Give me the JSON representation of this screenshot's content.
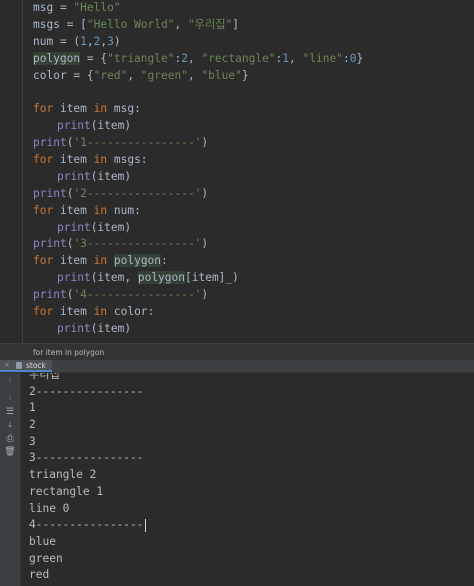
{
  "code": {
    "lines": [
      [
        {
          "t": "msg = "
        },
        {
          "t": "\"Hello\"",
          "c": "str"
        }
      ],
      [
        {
          "t": "msgs = ["
        },
        {
          "t": "\"Hello World\"",
          "c": "str"
        },
        {
          "t": ", "
        },
        {
          "t": "\"우리집\"",
          "c": "str"
        },
        {
          "t": "]"
        }
      ],
      [
        {
          "t": "num = ("
        },
        {
          "t": "1",
          "c": "num"
        },
        {
          "t": ","
        },
        {
          "t": "2",
          "c": "num"
        },
        {
          "t": ","
        },
        {
          "t": "3",
          "c": "num"
        },
        {
          "t": ")"
        }
      ],
      [
        {
          "t": "polygon",
          "c": "hl"
        },
        {
          "t": " = {"
        },
        {
          "t": "\"triangle\"",
          "c": "str"
        },
        {
          "t": ":"
        },
        {
          "t": "2",
          "c": "num"
        },
        {
          "t": ", "
        },
        {
          "t": "\"rectangle\"",
          "c": "str"
        },
        {
          "t": ":"
        },
        {
          "t": "1",
          "c": "num"
        },
        {
          "t": ", "
        },
        {
          "t": "\"line\"",
          "c": "str"
        },
        {
          "t": ":"
        },
        {
          "t": "0",
          "c": "num"
        },
        {
          "t": "}"
        }
      ],
      [
        {
          "t": "color = {"
        },
        {
          "t": "\"red\"",
          "c": "str"
        },
        {
          "t": ", "
        },
        {
          "t": "\"green\"",
          "c": "str"
        },
        {
          "t": ", "
        },
        {
          "t": "\"blue\"",
          "c": "str"
        },
        {
          "t": "}"
        }
      ],
      [],
      [
        {
          "t": "for",
          "c": "kw"
        },
        {
          "t": " item "
        },
        {
          "t": "in",
          "c": "kw"
        },
        {
          "t": " msg:"
        }
      ],
      [
        {
          "t": "",
          "c": "ind"
        },
        {
          "t": "print",
          "c": "fn"
        },
        {
          "t": "(item)"
        }
      ],
      [
        {
          "t": "print",
          "c": "fn"
        },
        {
          "t": "("
        },
        {
          "t": "'1----------------'",
          "c": "str"
        },
        {
          "t": ")"
        }
      ],
      [
        {
          "t": "for",
          "c": "kw"
        },
        {
          "t": " item "
        },
        {
          "t": "in",
          "c": "kw"
        },
        {
          "t": " msgs:"
        }
      ],
      [
        {
          "t": "",
          "c": "ind"
        },
        {
          "t": "print",
          "c": "fn"
        },
        {
          "t": "(item)"
        }
      ],
      [
        {
          "t": "print",
          "c": "fn"
        },
        {
          "t": "("
        },
        {
          "t": "'2----------------'",
          "c": "str"
        },
        {
          "t": ")"
        }
      ],
      [
        {
          "t": "for",
          "c": "kw"
        },
        {
          "t": " item "
        },
        {
          "t": "in",
          "c": "kw"
        },
        {
          "t": " num:"
        }
      ],
      [
        {
          "t": "",
          "c": "ind"
        },
        {
          "t": "print",
          "c": "fn"
        },
        {
          "t": "(item)"
        }
      ],
      [
        {
          "t": "print",
          "c": "fn"
        },
        {
          "t": "("
        },
        {
          "t": "'3----------------'",
          "c": "str"
        },
        {
          "t": ")"
        }
      ],
      [
        {
          "t": "for",
          "c": "kw"
        },
        {
          "t": " item "
        },
        {
          "t": "in",
          "c": "kw"
        },
        {
          "t": " "
        },
        {
          "t": "polygon",
          "c": "hl"
        },
        {
          "t": ":"
        }
      ],
      [
        {
          "t": "",
          "c": "ind"
        },
        {
          "t": "print",
          "c": "fn"
        },
        {
          "t": "(item, "
        },
        {
          "t": "polygon",
          "c": "hl"
        },
        {
          "t": "[item]_)"
        }
      ],
      [
        {
          "t": "print",
          "c": "fn"
        },
        {
          "t": "("
        },
        {
          "t": "'4----------------'",
          "c": "str"
        },
        {
          "t": ")"
        }
      ],
      [
        {
          "t": "for",
          "c": "kw"
        },
        {
          "t": " item "
        },
        {
          "t": "in",
          "c": "kw"
        },
        {
          "t": " color:"
        }
      ],
      [
        {
          "t": "",
          "c": "ind"
        },
        {
          "t": "print",
          "c": "fn"
        },
        {
          "t": "(item)"
        }
      ]
    ]
  },
  "breadcrumb": {
    "text": "for item in polygon"
  },
  "run_tab": {
    "label": "stock",
    "close_glyph": "×"
  },
  "toolbar": {
    "tools": [
      {
        "name": "rerun-up-icon",
        "glyph": "↑",
        "state": "dim"
      },
      {
        "name": "rerun-down-icon",
        "glyph": "↓",
        "state": "dim"
      },
      {
        "name": "soft-wrap-icon",
        "glyph": "☰",
        "state": "lit"
      },
      {
        "name": "scroll-to-end-icon",
        "glyph": "⇣",
        "state": "lit"
      },
      {
        "name": "print-icon",
        "glyph": "⎙",
        "state": "lit"
      },
      {
        "name": "trash-icon",
        "glyph": "🗑",
        "state": "lit"
      }
    ]
  },
  "console": {
    "lines": [
      "우리집",
      "2----------------",
      "1",
      "2",
      "3",
      "3----------------",
      "triangle 2",
      "rectangle 1",
      "line 0",
      "4----------------",
      "blue",
      "green",
      "red"
    ],
    "caret_after_line": 9
  },
  "colors": {
    "background": "#2b2b2b",
    "keyword": "#cc7832",
    "string": "#6a8759",
    "number": "#6897bb",
    "builtin": "#8888c6",
    "identifier_highlight": "#344134",
    "tab_underline": "#4a88c7"
  }
}
